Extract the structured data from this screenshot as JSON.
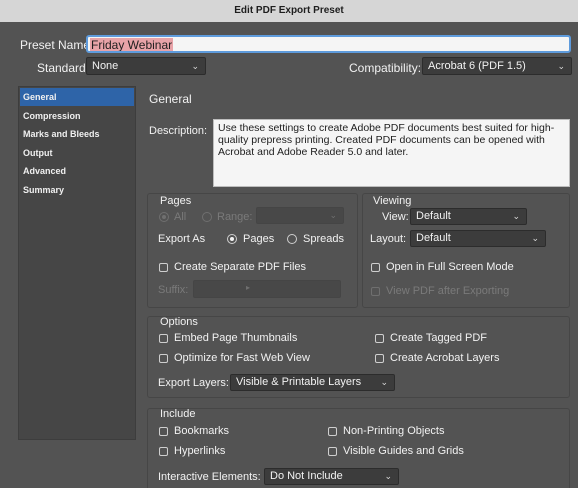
{
  "window": {
    "title": "Edit PDF Export Preset"
  },
  "preset": {
    "label": "Preset Name:",
    "value": "Friday Webinar"
  },
  "standard": {
    "label": "Standard:",
    "value": "None"
  },
  "compatibility": {
    "label": "Compatibility:",
    "value": "Acrobat 6 (PDF 1.5)"
  },
  "sidebar": {
    "items": [
      {
        "label": "General",
        "selected": true
      },
      {
        "label": "Compression"
      },
      {
        "label": "Marks and Bleeds"
      },
      {
        "label": "Output"
      },
      {
        "label": "Advanced"
      },
      {
        "label": "Summary"
      }
    ]
  },
  "panel": {
    "heading": "General",
    "description_label": "Description:",
    "description_text": "Use these settings to create Adobe PDF documents best suited for high-quality prepress printing.  Created PDF documents can be opened with Acrobat and Adobe Reader 5.0 and later."
  },
  "pages": {
    "title": "Pages",
    "all_label": "All",
    "range_label": "Range:",
    "range_value": "",
    "export_as_label": "Export As",
    "pages_label": "Pages",
    "spreads_label": "Spreads",
    "separate_label": "Create Separate PDF Files",
    "suffix_label": "Suffix:",
    "suffix_value": ""
  },
  "viewing": {
    "title": "Viewing",
    "view_label": "View:",
    "view_value": "Default",
    "layout_label": "Layout:",
    "layout_value": "Default",
    "fullscreen_label": "Open in Full Screen Mode",
    "viewafter_label": "View PDF after Exporting"
  },
  "options": {
    "title": "Options",
    "embed_thumbs": "Embed Page Thumbnails",
    "optimize": "Optimize for Fast Web View",
    "tagged": "Create Tagged PDF",
    "acrobat_layers": "Create Acrobat Layers",
    "export_layers_label": "Export Layers:",
    "export_layers_value": "Visible & Printable Layers"
  },
  "include": {
    "title": "Include",
    "bookmarks": "Bookmarks",
    "hyperlinks": "Hyperlinks",
    "nonprinting": "Non-Printing Objects",
    "guides": "Visible Guides and Grids",
    "interactive_label": "Interactive Elements:",
    "interactive_value": "Do Not Include"
  },
  "colors": {
    "accent": "#2e64a8",
    "focus_ring": "#5e9bdc",
    "highlight": "#e8a3a8"
  }
}
